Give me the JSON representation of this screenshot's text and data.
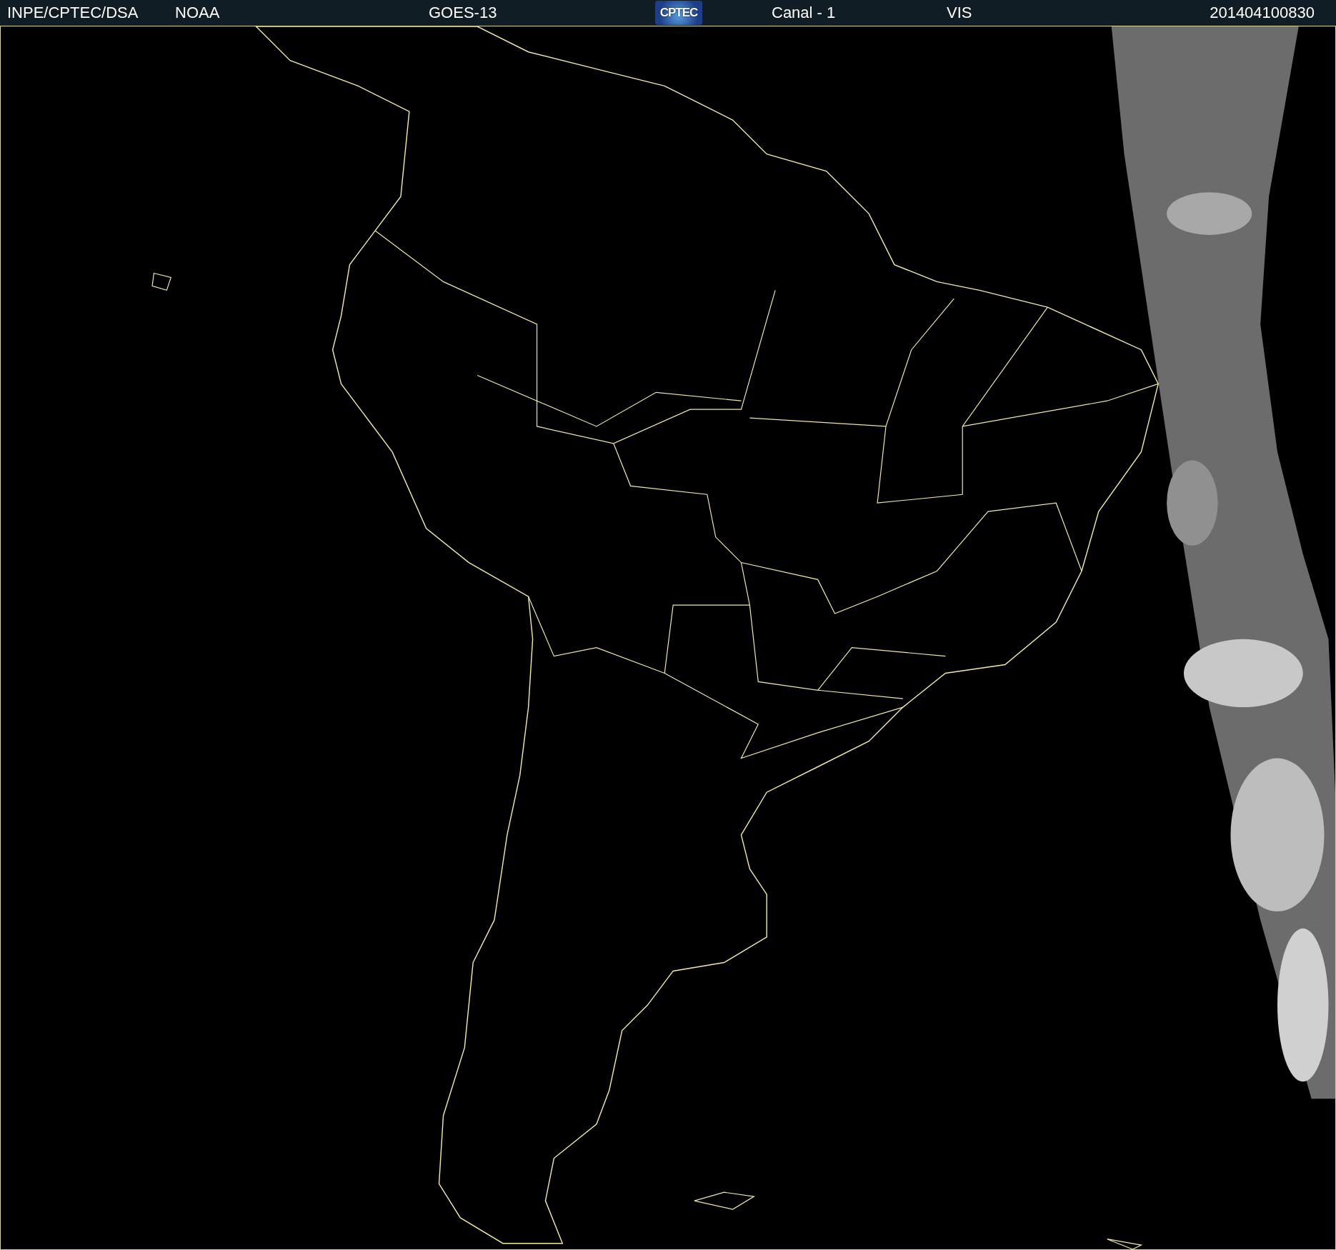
{
  "header": {
    "source": "INPE/CPTEC/DSA",
    "agency": "NOAA",
    "satellite": "GOES-13",
    "logo": "CPTEC",
    "channel": "Canal - 1",
    "band": "VIS",
    "timestamp": "201404100830"
  }
}
